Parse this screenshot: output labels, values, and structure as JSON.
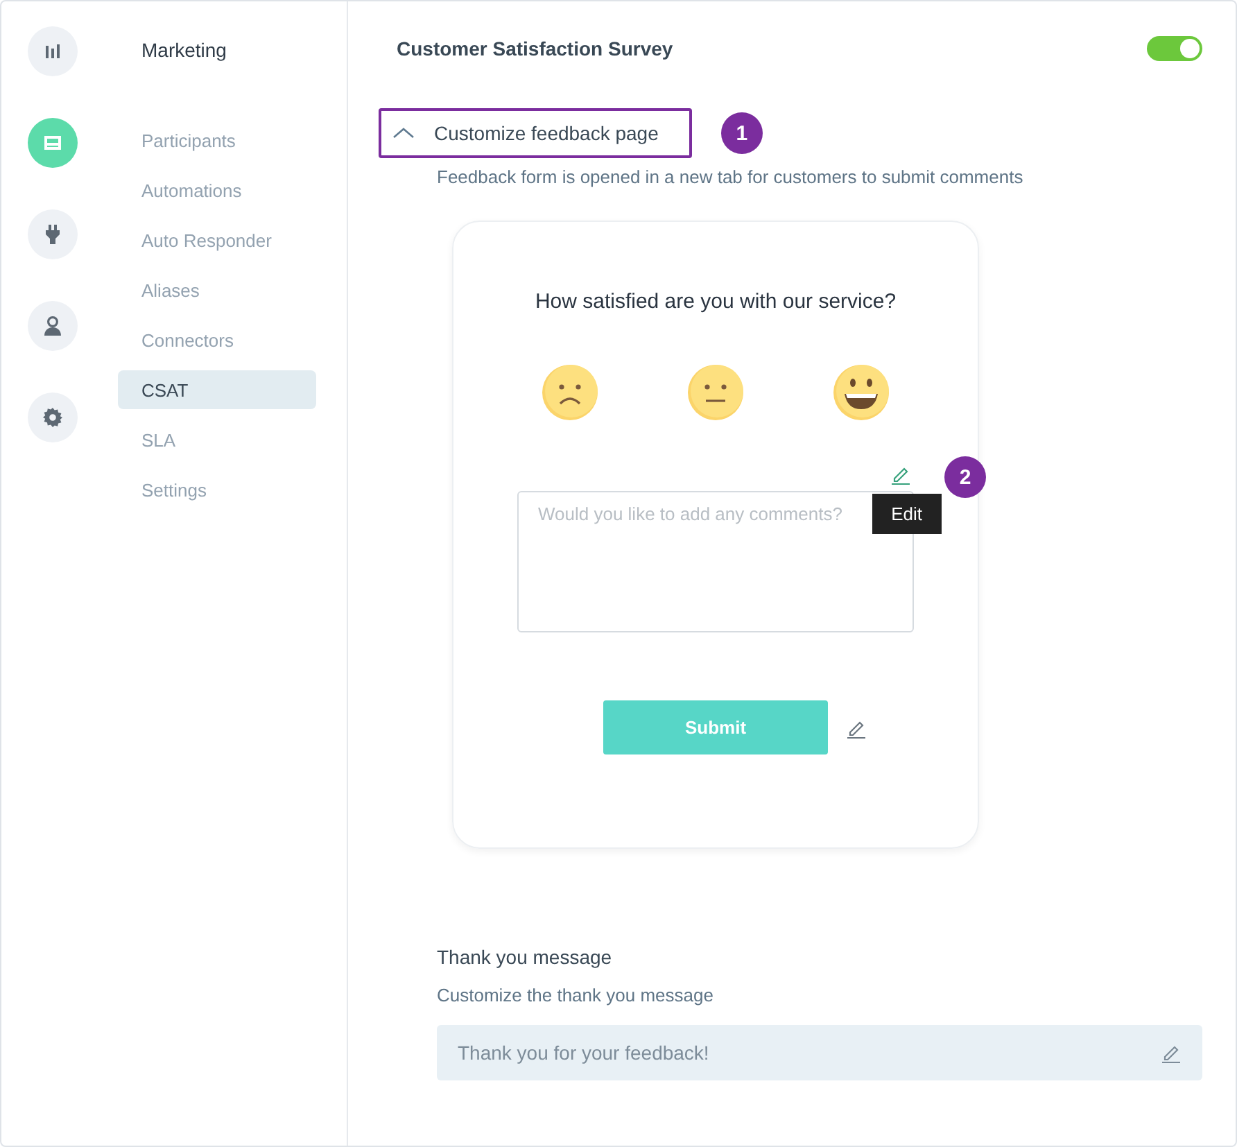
{
  "rail": [
    {
      "kind": "chart",
      "selected": false
    },
    {
      "kind": "inbox",
      "selected": true
    },
    {
      "kind": "plug",
      "selected": false
    },
    {
      "kind": "person",
      "selected": false
    },
    {
      "kind": "gear",
      "selected": false
    }
  ],
  "sidebar": {
    "title": "Marketing",
    "items": [
      {
        "label": "Participants",
        "selected": false
      },
      {
        "label": "Automations",
        "selected": false
      },
      {
        "label": "Auto Responder",
        "selected": false
      },
      {
        "label": "Aliases",
        "selected": false
      },
      {
        "label": "Connectors",
        "selected": false
      },
      {
        "label": "CSAT",
        "selected": true
      },
      {
        "label": "SLA",
        "selected": false
      },
      {
        "label": "Settings",
        "selected": false
      }
    ]
  },
  "header": {
    "title": "Customer Satisfaction Survey",
    "enabled": true
  },
  "section": {
    "title": "Customize feedback page",
    "expanded": true,
    "step": "1",
    "description": "Feedback form is opened in a new tab for customers to submit comments"
  },
  "preview": {
    "question": "How satisfied are you with our service?",
    "faces": [
      {
        "kind": "sad"
      },
      {
        "kind": "neutral"
      },
      {
        "kind": "happy"
      }
    ],
    "step": "2",
    "tooltip": "Edit",
    "comment_placeholder": "Would you like to add any comments?",
    "submit": "Submit"
  },
  "thank_you": {
    "title": "Thank you message",
    "description": "Customize the thank you message",
    "value": "Thank you for your feedback!"
  }
}
